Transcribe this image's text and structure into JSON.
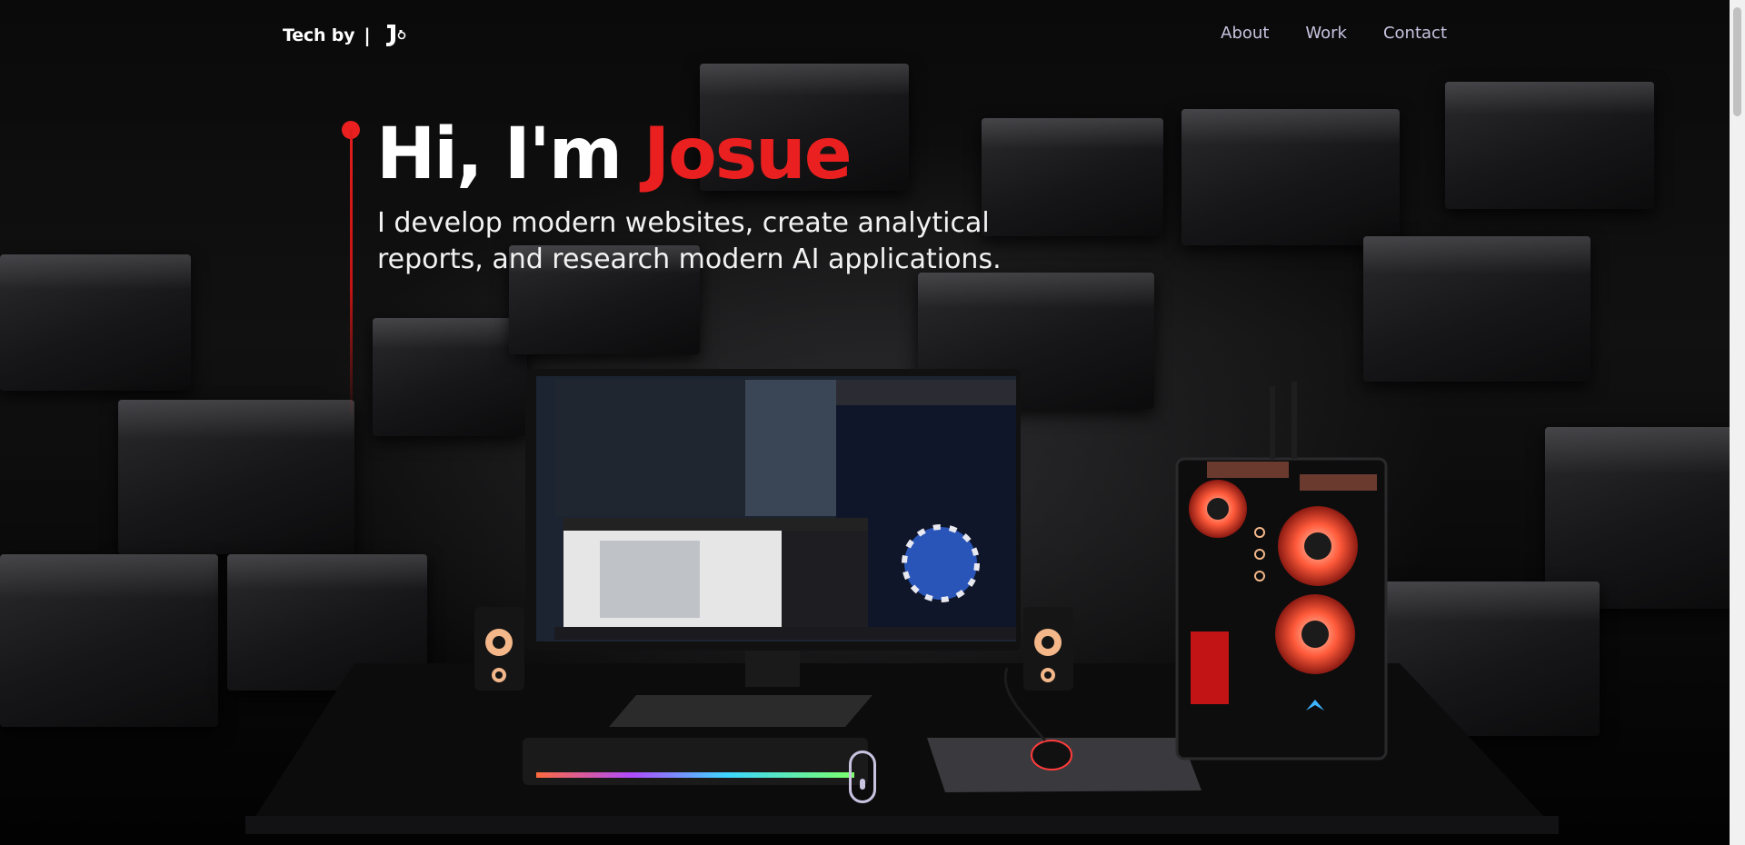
{
  "nav": {
    "logo_text": "Tech by",
    "logo_separator": "|",
    "logo_mark": "J",
    "links": [
      {
        "label": "About"
      },
      {
        "label": "Work"
      },
      {
        "label": "Contact"
      }
    ]
  },
  "hero": {
    "greeting": "Hi, I'm",
    "name": "Josue",
    "subtitle": "I develop modern websites, create analytical reports, and research modern AI applications."
  },
  "colors": {
    "accent": "#ea1f1f",
    "nav_link": "#c9c3e0",
    "background": "#050505"
  },
  "icons": {
    "scroll_hint": "mouse-scroll-icon",
    "logo": "j-logo-icon"
  }
}
